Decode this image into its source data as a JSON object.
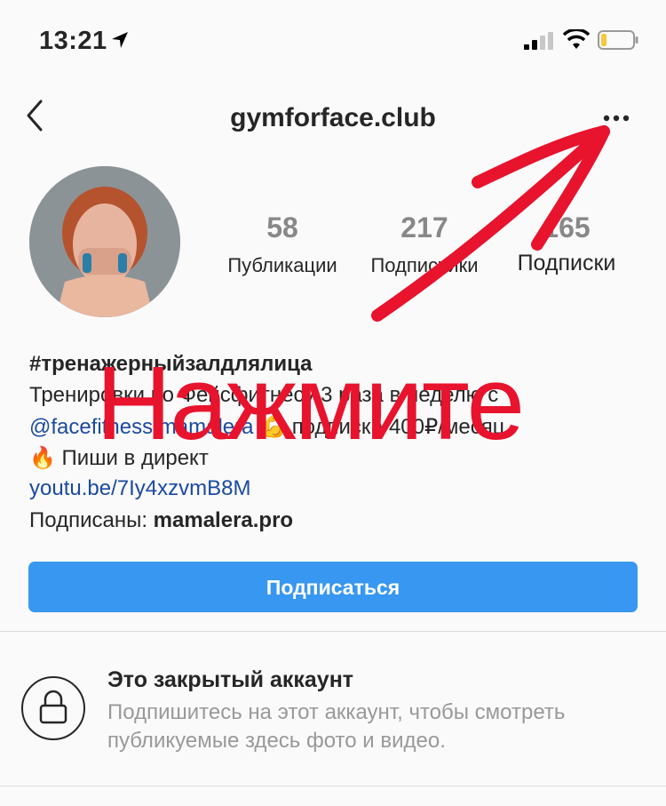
{
  "status_bar": {
    "time": "13:21",
    "icons": [
      "location-arrow-icon",
      "signal-icon",
      "wifi-icon",
      "battery-icon"
    ]
  },
  "header": {
    "title": "gymforface.club",
    "icons": [
      "back-chevron-icon",
      "more-options-icon"
    ]
  },
  "stats": [
    {
      "value": "58",
      "label": "Публикации"
    },
    {
      "value": "217",
      "label": "Подписчики"
    },
    {
      "value": "165",
      "label": "Подписки"
    }
  ],
  "bio": {
    "hashtag": "#тренажерныйзалдлялица",
    "line1": "Тренировки по Фейсфитнесу 3 раза в неделю с",
    "line2_mention": "@facefitness.mamalera",
    "line2_rest": " 💪 подписка 400₽/месяц",
    "line3": "🔥 Пиши в директ",
    "link": "youtu.be/7Iy4xzvmB8M",
    "followed_by_label": "Подписаны: ",
    "followed_by_name": "mamalera.pro"
  },
  "follow_button": "Подписаться",
  "private_account": {
    "title": "Это закрытый аккаунт",
    "text": "Подпишитесь на этот аккаунт, чтобы смотреть публикуемые здесь фото и видео.",
    "icon": "lock-icon"
  },
  "annotation": {
    "text": "Нажмите",
    "color": "#e8132d"
  },
  "colors": {
    "accent_button": "#3897f0",
    "link": "#1b4aa0",
    "background": "#fafafa",
    "battery_level": "#f5c842"
  }
}
